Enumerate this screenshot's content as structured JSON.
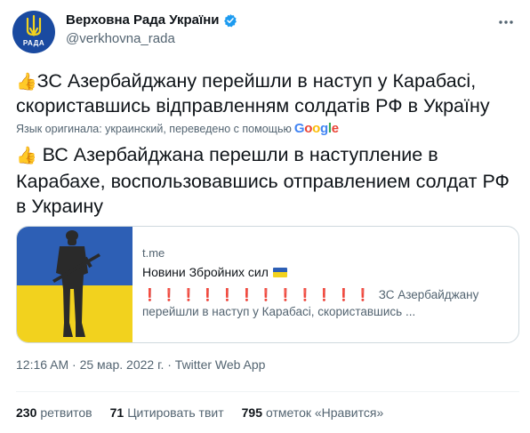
{
  "author": {
    "display_name": "Верховна Рада України",
    "handle": "@verkhovna_rada",
    "avatar_text": "РАДА",
    "avatar_icon": "trident-emblem",
    "verified_icon": "verified-badge-icon"
  },
  "tweet": {
    "emoji": "👍",
    "original_text": "ЗС Азербайджану перейшли в наступ у Карабасі, скориставшись відправленням солдатів РФ в Україну",
    "translation_note": "Язык оригинала: украинский, переведено с помощью",
    "translation_provider": "Google",
    "translated_text": "ВС Азербайджана перешли в наступление в Карабахе, воспользовавшись отправлением солдат РФ в Украину"
  },
  "card": {
    "domain": "t.me",
    "title": "Новини Збройних сил",
    "title_icon": "ukraine-flag-icon",
    "bangs": "❗❗❗❗❗❗❗❗❗❗❗❗",
    "description": "ЗС Азербайджану перейшли в наступ у Карабасі, скориставшись ..."
  },
  "meta": {
    "timestamp": "12:16 AM · 25 мар. 2022 г. · Twitter Web App"
  },
  "stats": {
    "retweets_count": "230",
    "retweets_label": "ретвитов",
    "quotes_count": "71",
    "quotes_label": "Цитировать твит",
    "likes_count": "795",
    "likes_label": "отметок «Нравится»"
  },
  "colors": {
    "accent": "#1d9bf0",
    "flag_blue": "#2d5fb5",
    "flag_yellow": "#f2d21e",
    "alert_red": "#d0202a"
  }
}
